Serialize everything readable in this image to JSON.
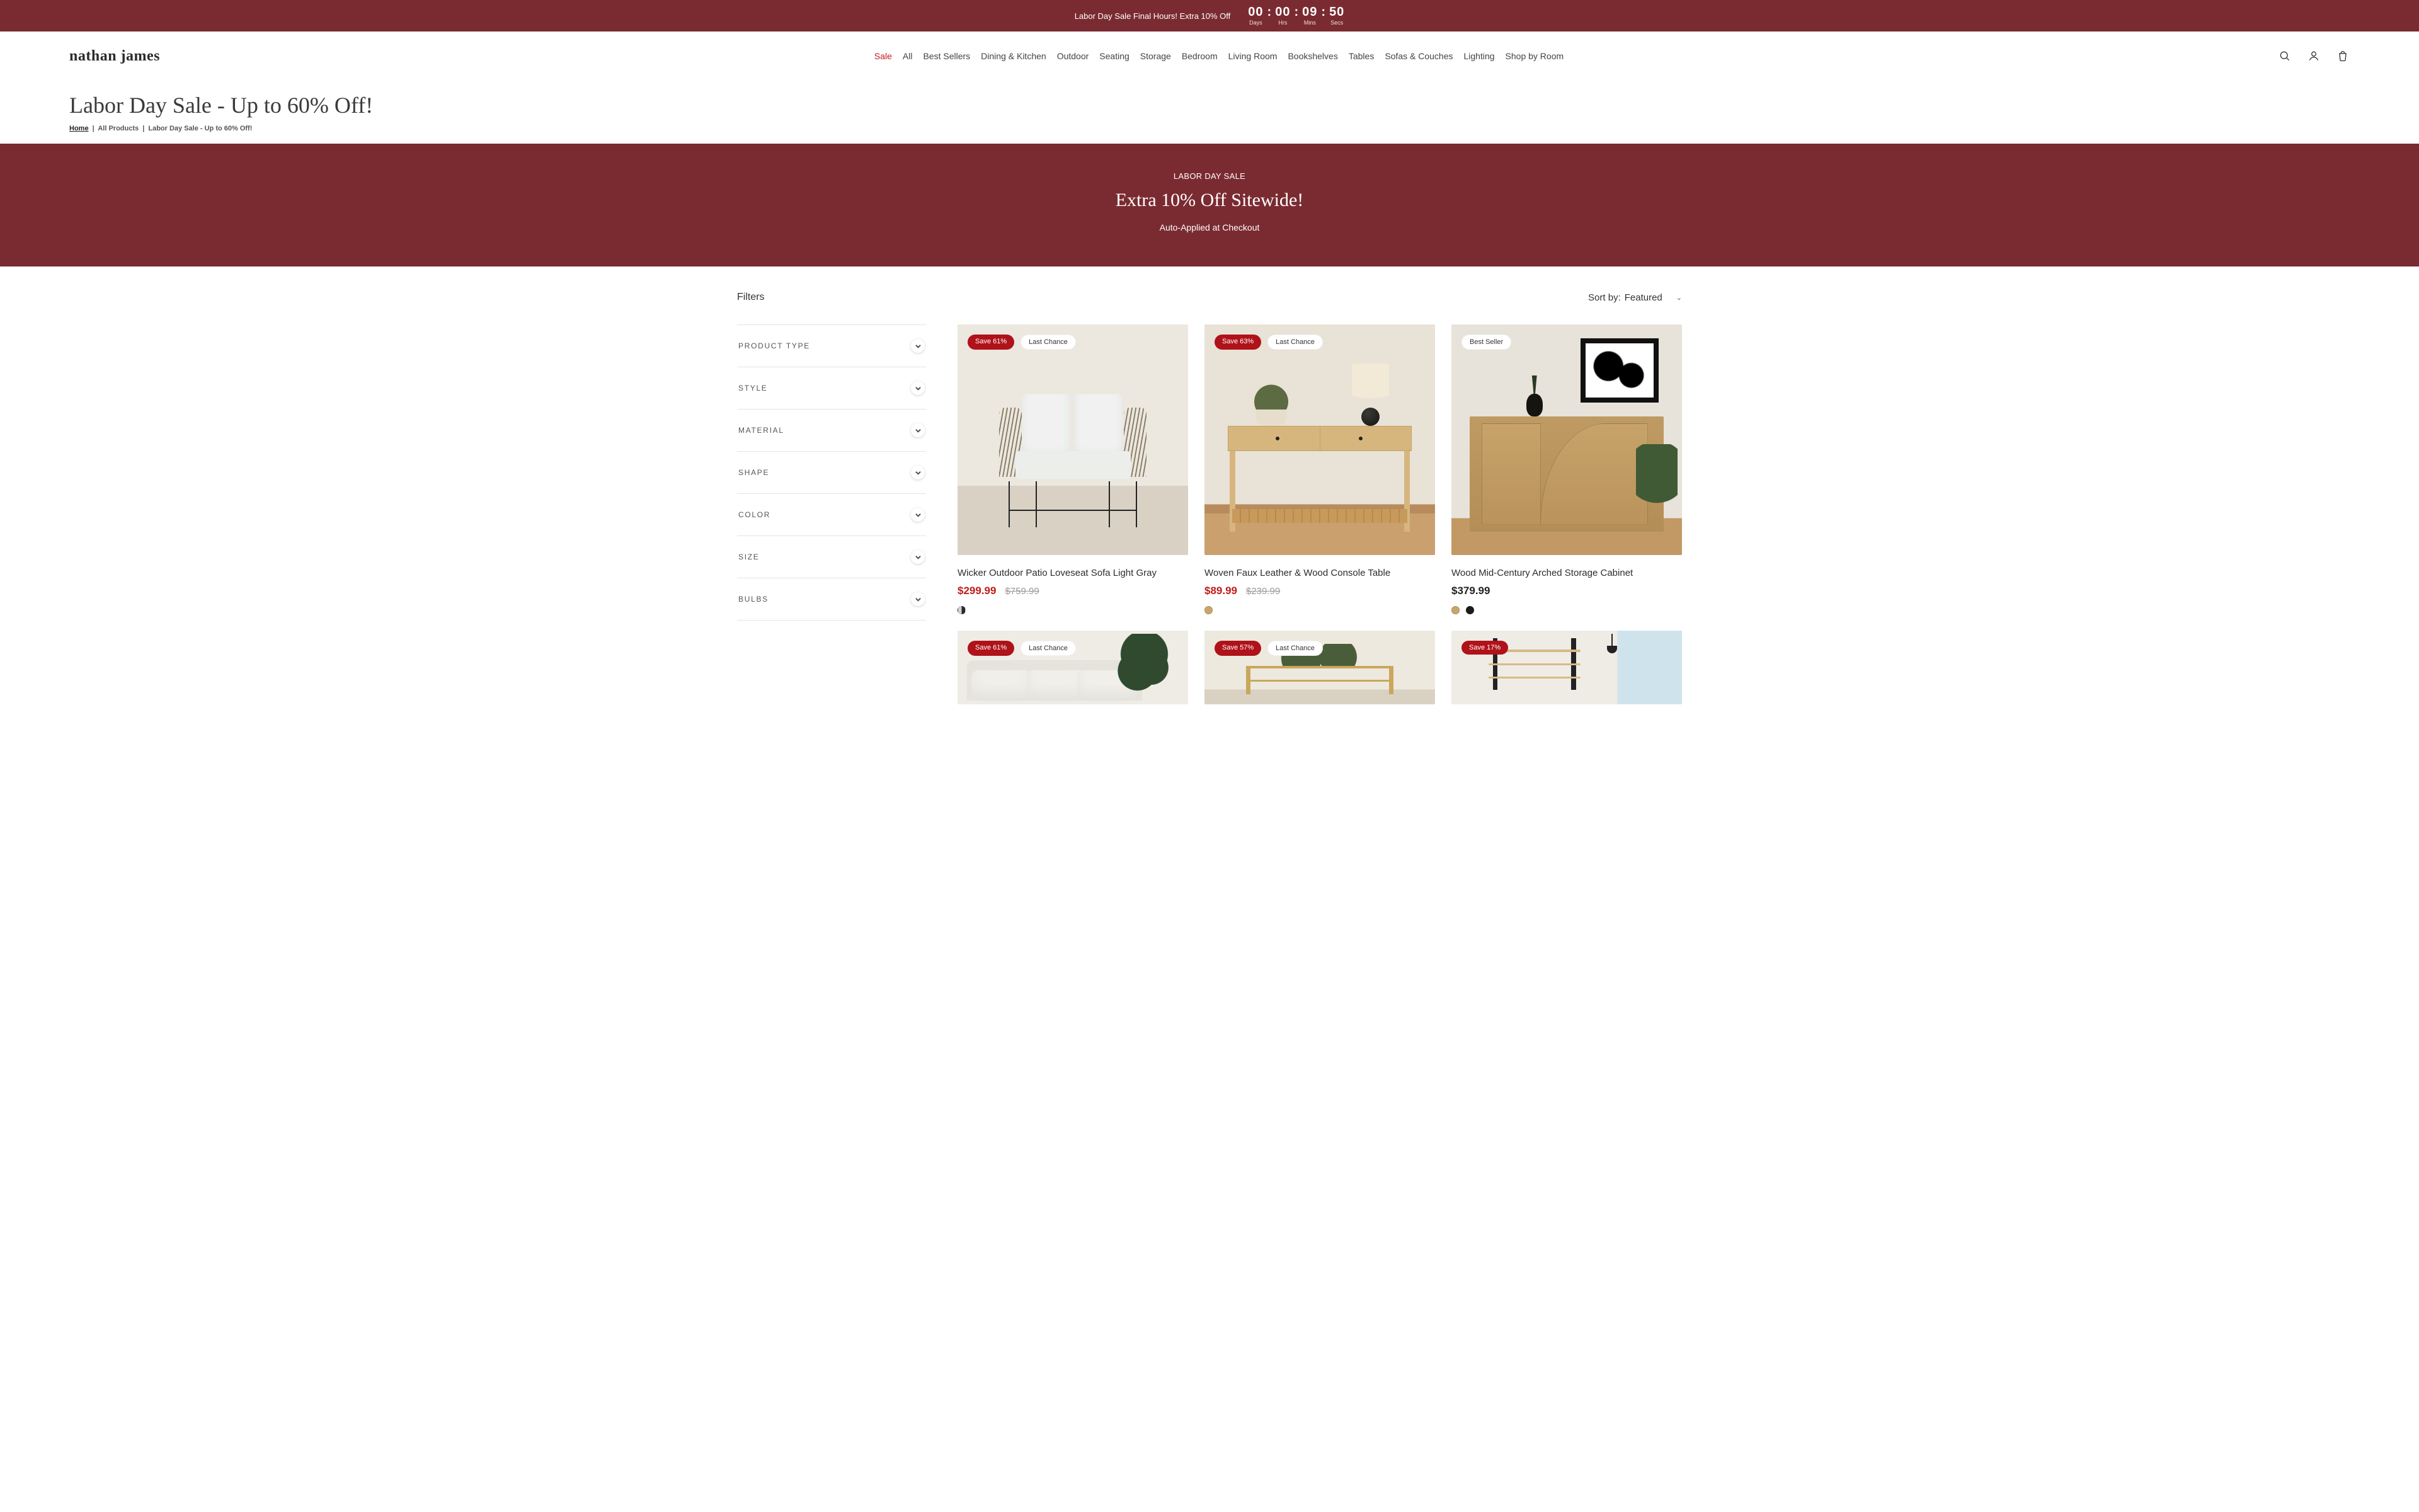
{
  "announcement": {
    "promo_text": "Labor Day Sale Final Hours! Extra 10% Off",
    "countdown": {
      "days": "00",
      "days_label": "Days",
      "hrs": "00",
      "hrs_label": "Hrs",
      "mins": "09",
      "mins_label": "Mins",
      "secs": "50",
      "secs_label": "Secs"
    }
  },
  "brand": {
    "name": "nathan james"
  },
  "nav": {
    "items": [
      "Sale",
      "All",
      "Best Sellers",
      "Dining & Kitchen",
      "Outdoor",
      "Seating",
      "Storage",
      "Bedroom",
      "Living Room",
      "Bookshelves",
      "Tables",
      "Sofas & Couches",
      "Lighting",
      "Shop by Room"
    ]
  },
  "heading": {
    "title": "Labor Day Sale - Up to 60% Off!",
    "crumbs": {
      "home": "Home",
      "all": "All Products",
      "current": "Labor Day Sale - Up to 60% Off!"
    }
  },
  "hero": {
    "eyebrow": "LABOR DAY SALE",
    "title": "Extra 10% Off Sitewide!",
    "sub": "Auto-Applied at Checkout"
  },
  "toolbar": {
    "filters_label": "Filters",
    "sort_prefix": "Sort by:",
    "sort_value": "Featured"
  },
  "facets": [
    "PRODUCT TYPE",
    "STYLE",
    "MATERIAL",
    "SHAPE",
    "COLOR",
    "SIZE",
    "BULBS"
  ],
  "products": [
    {
      "title": "Wicker Outdoor Patio Loveseat Sofa Light Gray",
      "save": "Save 61%",
      "chip": "Last Chance",
      "price": "$299.99",
      "compare": "$759.99",
      "on_sale": true,
      "swatches": [
        "split:#d4d4d4:#2b2b2b"
      ]
    },
    {
      "title": "Woven Faux Leather & Wood Console Table",
      "save": "Save 63%",
      "chip": "Last Chance",
      "price": "$89.99",
      "compare": "$239.99",
      "on_sale": true,
      "swatches": [
        "#c9a66a"
      ]
    },
    {
      "title": "Wood Mid-Century Arched Storage Cabinet",
      "save": "",
      "chip": "Best Seller",
      "price": "$379.99",
      "compare": "",
      "on_sale": false,
      "swatches": [
        "#c9a66a",
        "#1c1c1c"
      ]
    },
    {
      "title": "",
      "save": "Save 61%",
      "chip": "Last Chance",
      "price": "",
      "compare": "",
      "on_sale": true,
      "swatches": []
    },
    {
      "title": "",
      "save": "Save 57%",
      "chip": "Last Chance",
      "price": "",
      "compare": "",
      "on_sale": true,
      "swatches": []
    },
    {
      "title": "",
      "save": "Save 17%",
      "chip": "",
      "price": "",
      "compare": "",
      "on_sale": true,
      "swatches": []
    }
  ]
}
